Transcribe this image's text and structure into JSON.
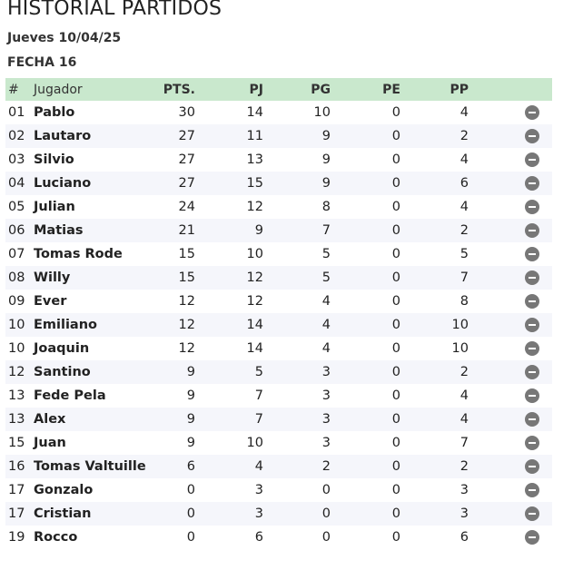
{
  "page": {
    "title": "HISTORIAL PARTIDOS",
    "date": "Jueves 10/04/25",
    "fecha": "FECHA 16"
  },
  "table": {
    "headers": {
      "num": "#",
      "name": "Jugador",
      "pts": "PTS.",
      "pj": "PJ",
      "pg": "PG",
      "pe": "PE",
      "pp": "PP"
    },
    "rows": [
      {
        "pos": "01",
        "name": "Pablo",
        "pts": "30",
        "pj": "14",
        "pg": "10",
        "pe": "0",
        "pp": "4"
      },
      {
        "pos": "02",
        "name": "Lautaro",
        "pts": "27",
        "pj": "11",
        "pg": "9",
        "pe": "0",
        "pp": "2"
      },
      {
        "pos": "03",
        "name": "Silvio",
        "pts": "27",
        "pj": "13",
        "pg": "9",
        "pe": "0",
        "pp": "4"
      },
      {
        "pos": "04",
        "name": "Luciano",
        "pts": "27",
        "pj": "15",
        "pg": "9",
        "pe": "0",
        "pp": "6"
      },
      {
        "pos": "05",
        "name": "Julian",
        "pts": "24",
        "pj": "12",
        "pg": "8",
        "pe": "0",
        "pp": "4"
      },
      {
        "pos": "06",
        "name": "Matias",
        "pts": "21",
        "pj": "9",
        "pg": "7",
        "pe": "0",
        "pp": "2"
      },
      {
        "pos": "07",
        "name": "Tomas Rode",
        "pts": "15",
        "pj": "10",
        "pg": "5",
        "pe": "0",
        "pp": "5"
      },
      {
        "pos": "08",
        "name": "Willy",
        "pts": "15",
        "pj": "12",
        "pg": "5",
        "pe": "0",
        "pp": "7"
      },
      {
        "pos": "09",
        "name": "Ever",
        "pts": "12",
        "pj": "12",
        "pg": "4",
        "pe": "0",
        "pp": "8"
      },
      {
        "pos": "10",
        "name": "Emiliano",
        "pts": "12",
        "pj": "14",
        "pg": "4",
        "pe": "0",
        "pp": "10"
      },
      {
        "pos": "10",
        "name": "Joaquin",
        "pts": "12",
        "pj": "14",
        "pg": "4",
        "pe": "0",
        "pp": "10"
      },
      {
        "pos": "12",
        "name": "Santino",
        "pts": "9",
        "pj": "5",
        "pg": "3",
        "pe": "0",
        "pp": "2"
      },
      {
        "pos": "13",
        "name": "Fede Pela",
        "pts": "9",
        "pj": "7",
        "pg": "3",
        "pe": "0",
        "pp": "4"
      },
      {
        "pos": "13",
        "name": "Alex",
        "pts": "9",
        "pj": "7",
        "pg": "3",
        "pe": "0",
        "pp": "4"
      },
      {
        "pos": "15",
        "name": "Juan",
        "pts": "9",
        "pj": "10",
        "pg": "3",
        "pe": "0",
        "pp": "7"
      },
      {
        "pos": "16",
        "name": "Tomas Valtuille",
        "pts": "6",
        "pj": "4",
        "pg": "2",
        "pe": "0",
        "pp": "2"
      },
      {
        "pos": "17",
        "name": "Gonzalo",
        "pts": "0",
        "pj": "3",
        "pg": "0",
        "pe": "0",
        "pp": "3"
      },
      {
        "pos": "17",
        "name": "Cristian",
        "pts": "0",
        "pj": "3",
        "pg": "0",
        "pe": "0",
        "pp": "3"
      },
      {
        "pos": "19",
        "name": "Rocco",
        "pts": "0",
        "pj": "6",
        "pg": "0",
        "pe": "0",
        "pp": "6"
      }
    ]
  },
  "icons": {
    "row_action": "minus-circle-icon"
  },
  "colors": {
    "header_bg": "#c9e8cd",
    "alt_row_bg": "#f5f6fb",
    "icon": "#777777"
  }
}
